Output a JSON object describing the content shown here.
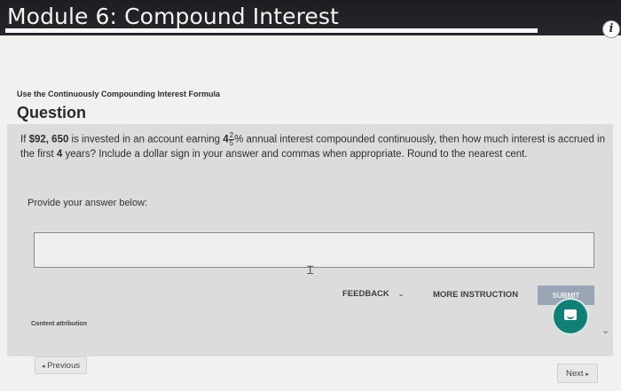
{
  "header": {
    "title": "Module 6: Compound Interest",
    "info_icon": "info-icon"
  },
  "content": {
    "subheading": "Use the Continuously Compounding Interest Formula",
    "question_heading": "Question",
    "question": {
      "part1": "If ",
      "principal": "$92, 650",
      "part2": " is invested in an account earning ",
      "rate_whole": "4",
      "rate_num": "2",
      "rate_den": "5",
      "rate_suffix": "%",
      "part3": " annual interest compounded continuously, then how much interest is accrued in the first ",
      "years": "4",
      "part4": " years? Include a dollar sign in your answer and commas when appropriate. Round to the nearest cent."
    },
    "answer_label": "Provide your answer below:",
    "answer_value": "",
    "attribution": "Content attribution"
  },
  "actions": {
    "feedback": "FEEDBACK",
    "feedback_chevron": "⌄",
    "more_instruction": "MORE INSTRUCTION",
    "submit": "SUBMIT",
    "chat_icon": "chat-icon",
    "collapse_icon": "chevron-down-icon"
  },
  "navigation": {
    "previous": "Previous",
    "next": "Next"
  },
  "colors": {
    "topbar": "#1d1d22",
    "submit": "#9aa6b5",
    "chat": "#127f76",
    "panel": "#dcdcdc"
  }
}
